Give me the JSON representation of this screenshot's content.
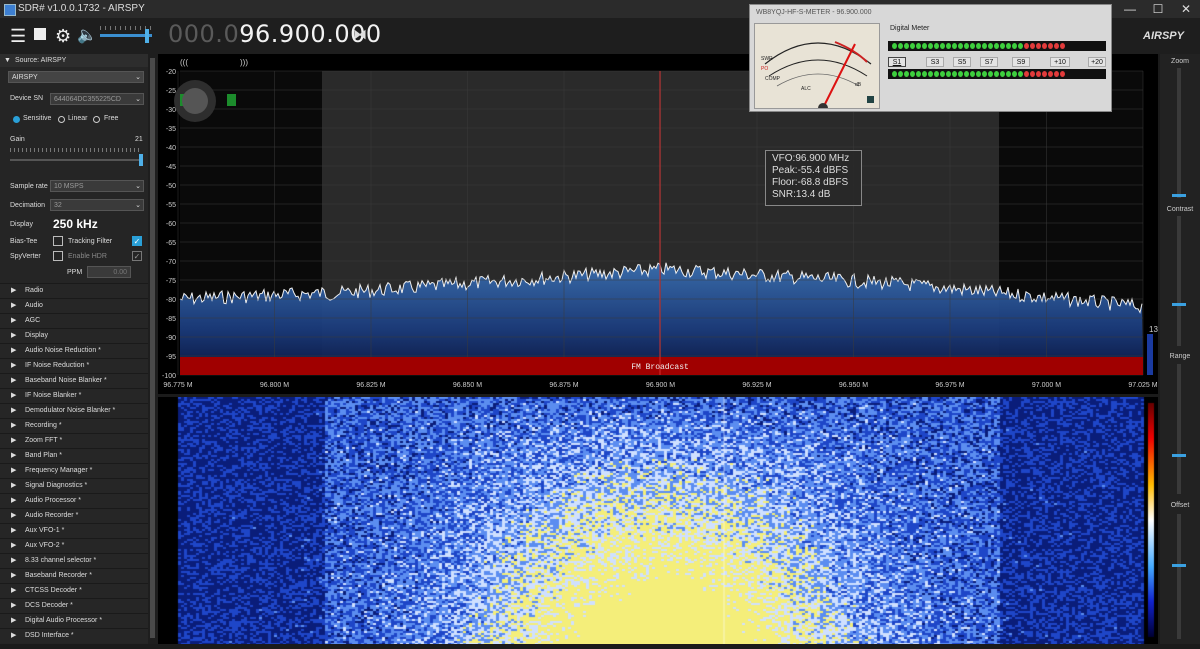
{
  "window": {
    "title": "SDR# v1.0.0.1732 - AIRSPY",
    "minimize": "—",
    "maximize": "☐",
    "close": "✕"
  },
  "toolbar": {
    "menu_icon": "hamburger-icon",
    "stop_icon": "stop-icon",
    "settings_icon": "gear-icon",
    "volume_icon": "speaker-icon",
    "freq_dim": "000.0",
    "freq_bright": "96.900.000",
    "tune_icon": "tuning-mode-icon",
    "logo": "AIRSPY"
  },
  "source": {
    "header": "Source: AIRSPY",
    "device": "AIRSPY",
    "device_sn_label": "Device SN",
    "device_sn": "644064DC355225CD",
    "modes": [
      "Sensitive",
      "Linear",
      "Free"
    ],
    "selected_mode": "Sensitive",
    "gain_label": "Gain",
    "gain_value": "21",
    "sample_rate_label": "Sample rate",
    "sample_rate": "10 MSPS",
    "decimation_label": "Decimation",
    "decimation": "32",
    "display_label": "Display",
    "display_value": "250 kHz",
    "bias_tee_label": "Bias-Tee",
    "tracking_filter_label": "Tracking Filter",
    "spyverter_label": "SpyVerter",
    "enable_hdr_label": "Enable HDR",
    "ppm_label": "PPM",
    "ppm_value": "0.00"
  },
  "plugins": [
    "Radio",
    "Audio",
    "AGC",
    "Display",
    "Audio Noise Reduction *",
    "IF Noise Reduction *",
    "Baseband Noise Blanker *",
    "IF Noise Blanker *",
    "Demodulator Noise Blanker *",
    "Recording *",
    "Zoom FFT *",
    "Band Plan *",
    "Frequency Manager *",
    "Signal Diagnostics *",
    "Audio Processor *",
    "Audio Recorder *",
    "Aux VFO-1 *",
    "Aux VFO-2 *",
    "8.33 channel selector *",
    "Baseband Recorder *",
    "CTCSS Decoder *",
    "DCS Decoder *",
    "Digital Audio Processor *",
    "DSD Interface *"
  ],
  "spectrum": {
    "y_ticks": [
      "-20",
      "-25",
      "-30",
      "-35",
      "-40",
      "-45",
      "-50",
      "-55",
      "-60",
      "-65",
      "-70",
      "-75",
      "-80",
      "-85",
      "-90",
      "-95",
      "-100"
    ],
    "x_ticks": [
      "96.775 M",
      "96.800 M",
      "96.825 M",
      "96.850 M",
      "96.875 M",
      "96.900 M",
      "96.925 M",
      "96.950 M",
      "96.975 M",
      "97.000 M",
      "97.025 M"
    ],
    "band_label": "FM Broadcast",
    "vfo": "VFO:96.900 MHz",
    "peak": "Peak:-55.4 dBFS",
    "floor": "Floor:-68.8 dBFS",
    "snr": "SNR:13.4 dB",
    "left_marks": "(((",
    "right_marks": ")))",
    "snr_value": "13"
  },
  "right_panel": {
    "zoom": "Zoom",
    "contrast": "Contrast",
    "range": "Range",
    "offset": "Offset"
  },
  "smeter": {
    "title": "WB8YQJ-HF-S-METER - 96.900.000",
    "digital_label": "Digital Meter",
    "buttons": [
      "S1",
      "S3",
      "S5",
      "S7",
      "S9",
      "+10",
      "+20"
    ],
    "dial_labels": [
      "COMP",
      "ALC",
      "PO",
      "SWR",
      "dB"
    ]
  },
  "colors": {
    "accent": "#2aa0d8",
    "band": "#a00000",
    "vfo_line": "#d03030"
  }
}
